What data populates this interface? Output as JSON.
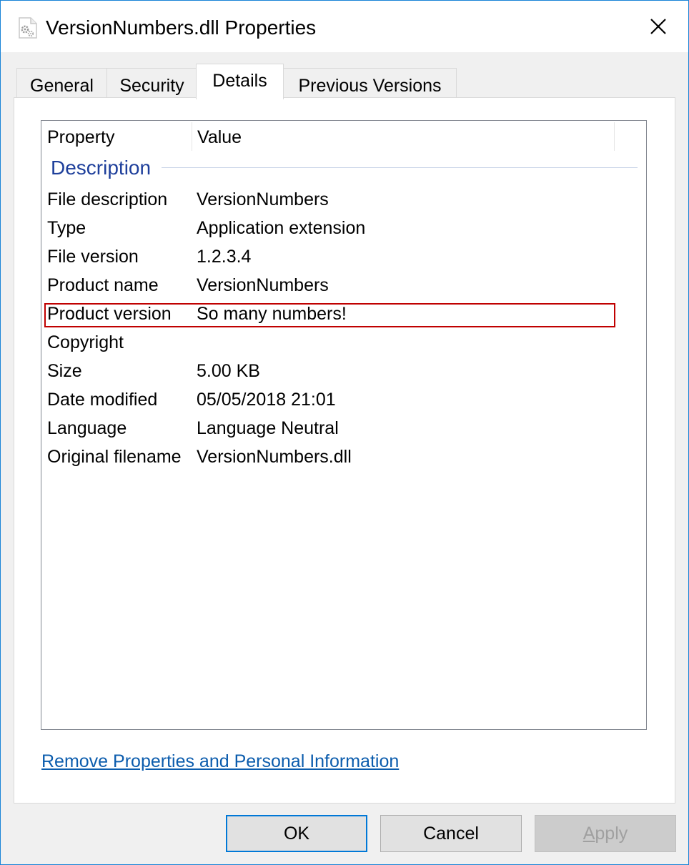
{
  "window": {
    "title": "VersionNumbers.dll Properties",
    "accent_color": "#1883d7",
    "close_icon": "close-icon"
  },
  "tabs": [
    {
      "label": "General",
      "active": false
    },
    {
      "label": "Security",
      "active": false
    },
    {
      "label": "Details",
      "active": true
    },
    {
      "label": "Previous Versions",
      "active": false
    }
  ],
  "details": {
    "columns": {
      "property": "Property",
      "value": "Value"
    },
    "group": "Description",
    "rows": [
      {
        "property": "File description",
        "value": "VersionNumbers"
      },
      {
        "property": "Type",
        "value": "Application extension"
      },
      {
        "property": "File version",
        "value": "1.2.3.4"
      },
      {
        "property": "Product name",
        "value": "VersionNumbers"
      },
      {
        "property": "Product version",
        "value": "So many numbers!"
      },
      {
        "property": "Copyright",
        "value": ""
      },
      {
        "property": "Size",
        "value": "5.00 KB"
      },
      {
        "property": "Date modified",
        "value": "05/05/2018 21:01"
      },
      {
        "property": "Language",
        "value": "Language Neutral"
      },
      {
        "property": "Original filename",
        "value": "VersionNumbers.dll"
      }
    ],
    "highlight_color": "#c00000"
  },
  "remove_link": "Remove Properties and Personal Information",
  "buttons": {
    "ok": "OK",
    "cancel": "Cancel",
    "apply_first": "A",
    "apply_rest": "pply"
  }
}
